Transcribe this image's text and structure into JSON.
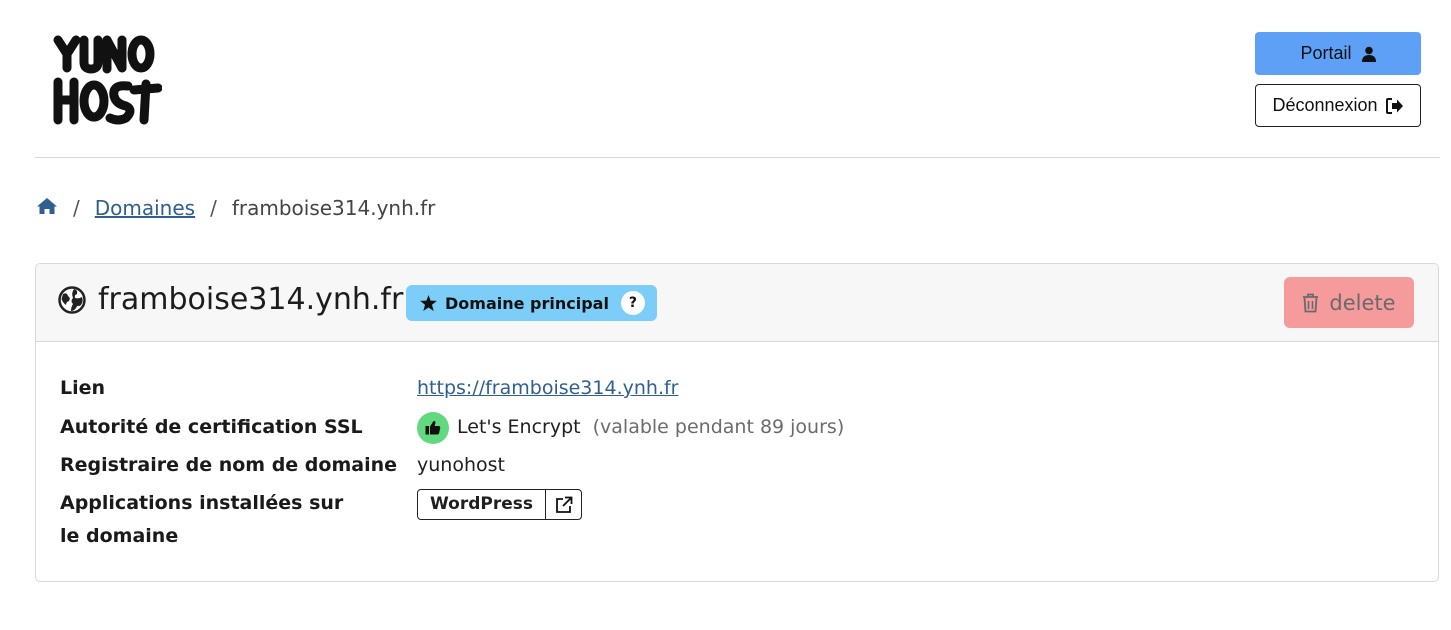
{
  "header": {
    "logo_text": "YUNO HOST",
    "portal_label": "Portail",
    "logout_label": "Déconnexion"
  },
  "breadcrumb": {
    "home_icon": "home-icon",
    "items": [
      "Domaines",
      "framboise314.ynh.fr"
    ]
  },
  "domain": {
    "name": "framboise314.ynh.fr",
    "badge_label": "Domaine principal",
    "badge_help": "?",
    "delete_label": "delete"
  },
  "details": {
    "link_label": "Lien",
    "link_value": "https://framboise314.ynh.fr",
    "ssl_label": "Autorité de certification SSL",
    "ssl_value": "Let's Encrypt",
    "ssl_validity": "(valable pendant 89 jours)",
    "registrar_label": "Registraire de nom de domaine",
    "registrar_value": "yunohost",
    "apps_label": "Applications installées sur le domaine",
    "apps": [
      "WordPress"
    ]
  },
  "colors": {
    "primary": "#5fa0f7",
    "info": "#7ccdf7",
    "danger": "#f69b9b",
    "success": "#63d97f",
    "link": "#2f5f8f"
  }
}
